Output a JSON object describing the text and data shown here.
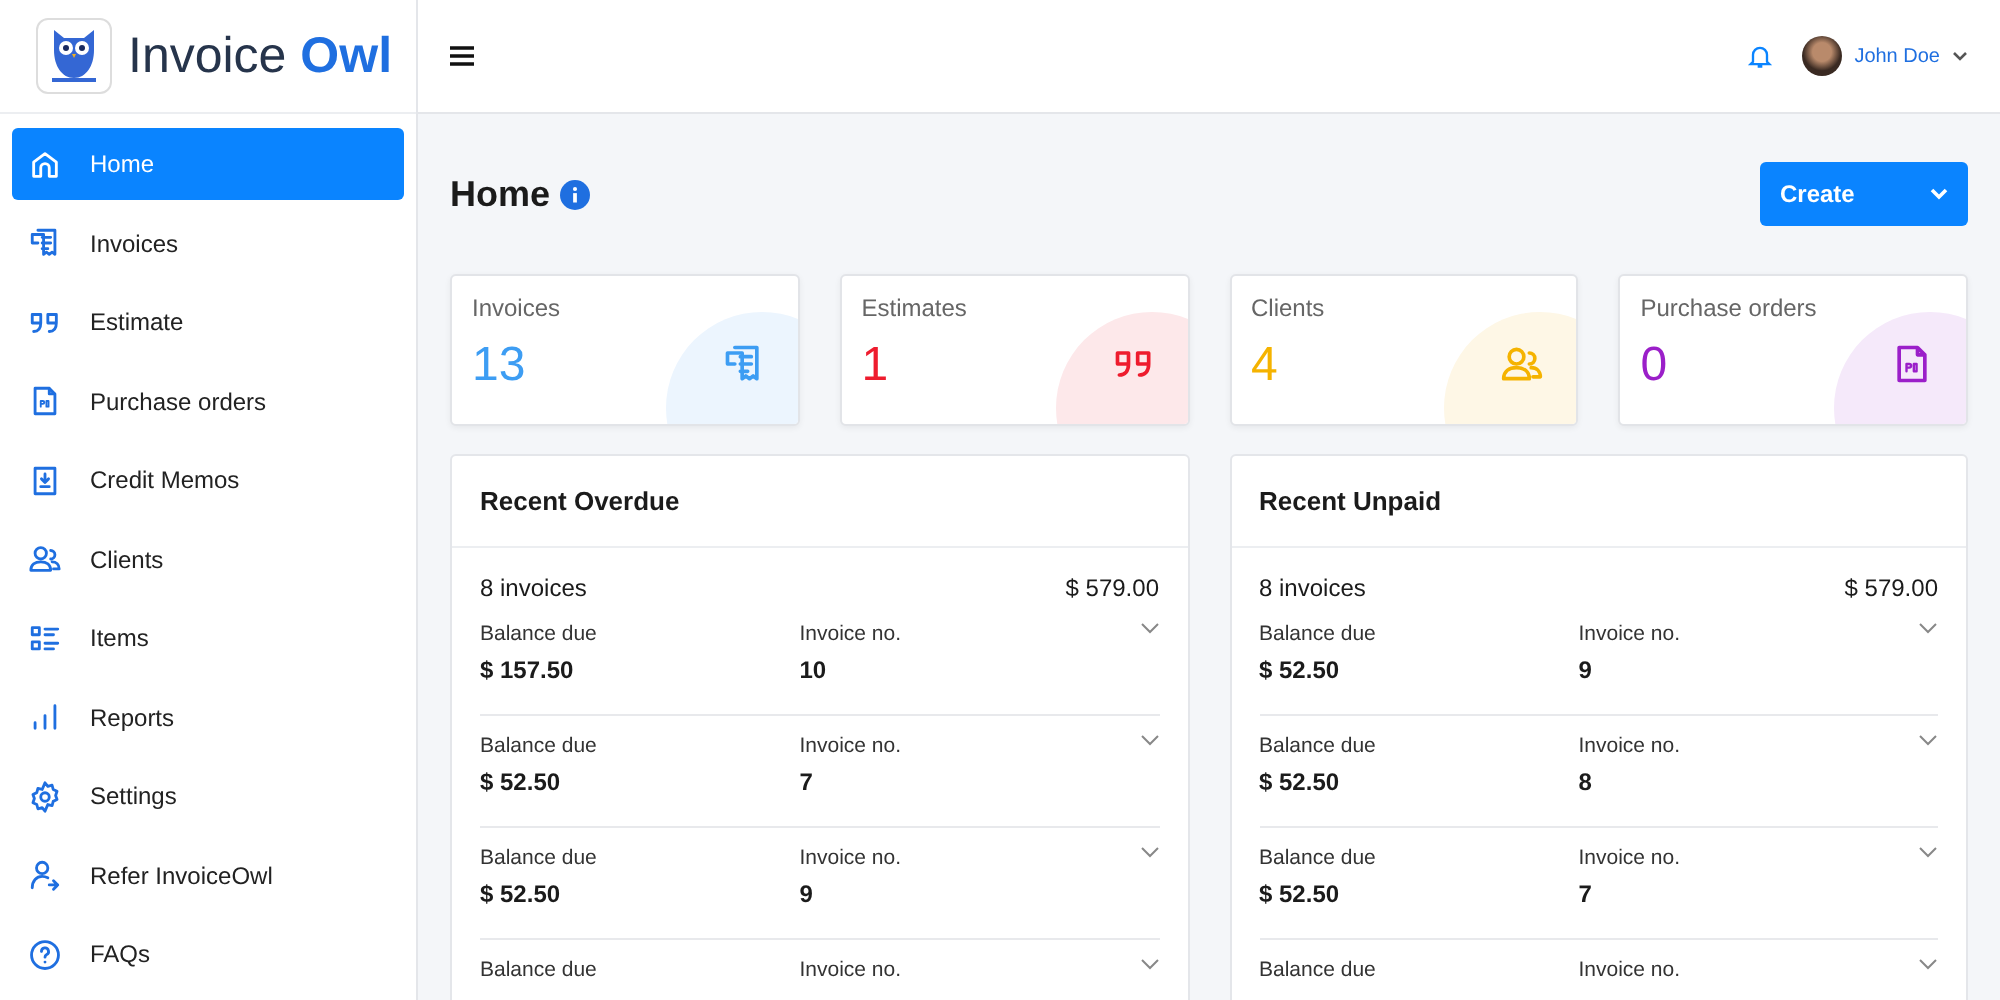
{
  "brand": {
    "name_part1": "Invoice",
    "name_part2": "Owl"
  },
  "sidebar": {
    "items": [
      {
        "label": "Home",
        "kind": "home",
        "selected": true
      },
      {
        "label": "Invoices",
        "kind": "invoice",
        "selected": false
      },
      {
        "label": "Estimate",
        "kind": "quote",
        "selected": false
      },
      {
        "label": "Purchase orders",
        "kind": "po",
        "selected": false
      },
      {
        "label": "Credit Memos",
        "kind": "memo",
        "selected": false
      },
      {
        "label": "Clients",
        "kind": "clients",
        "selected": false
      },
      {
        "label": "Items",
        "kind": "items",
        "selected": false
      },
      {
        "label": "Reports",
        "kind": "reports",
        "selected": false
      },
      {
        "label": "Settings",
        "kind": "settings",
        "selected": false
      },
      {
        "label": "Refer InvoiceOwl",
        "kind": "refer",
        "selected": false
      },
      {
        "label": "FAQs",
        "kind": "faq",
        "selected": false
      }
    ]
  },
  "topbar": {
    "user": "John Doe"
  },
  "page": {
    "title": "Home",
    "create_button": "Create"
  },
  "stats": [
    {
      "label": "Invoices",
      "value": "13",
      "kind": "invoice",
      "color": "#3d9df3"
    },
    {
      "label": "Estimates",
      "value": "1",
      "kind": "quote",
      "color": "#ee1c2e"
    },
    {
      "label": "Clients",
      "value": "4",
      "kind": "clients",
      "color": "#f5b300"
    },
    {
      "label": "Purchase orders",
      "value": "0",
      "kind": "po",
      "color": "#9b1fc9"
    }
  ],
  "panels": [
    {
      "title": "Recent Overdue",
      "count": "8 invoices",
      "total": "$ 579.00",
      "rows": [
        {
          "balance_label": "Balance due",
          "balance": "$ 157.50",
          "number_label": "Invoice no.",
          "number": "10"
        },
        {
          "balance_label": "Balance due",
          "balance": "$ 52.50",
          "number_label": "Invoice no.",
          "number": "7"
        },
        {
          "balance_label": "Balance due",
          "balance": "$ 52.50",
          "number_label": "Invoice no.",
          "number": "9"
        },
        {
          "balance_label": "Balance due",
          "number_label": "Invoice no."
        }
      ]
    },
    {
      "title": "Recent Unpaid",
      "count": "8 invoices",
      "total": "$ 579.00",
      "rows": [
        {
          "balance_label": "Balance due",
          "balance": "$ 52.50",
          "number_label": "Invoice no.",
          "number": "9"
        },
        {
          "balance_label": "Balance due",
          "balance": "$ 52.50",
          "number_label": "Invoice no.",
          "number": "8"
        },
        {
          "balance_label": "Balance due",
          "balance": "$ 52.50",
          "number_label": "Invoice no.",
          "number": "7"
        },
        {
          "balance_label": "Balance due",
          "number_label": "Invoice no."
        }
      ]
    }
  ]
}
